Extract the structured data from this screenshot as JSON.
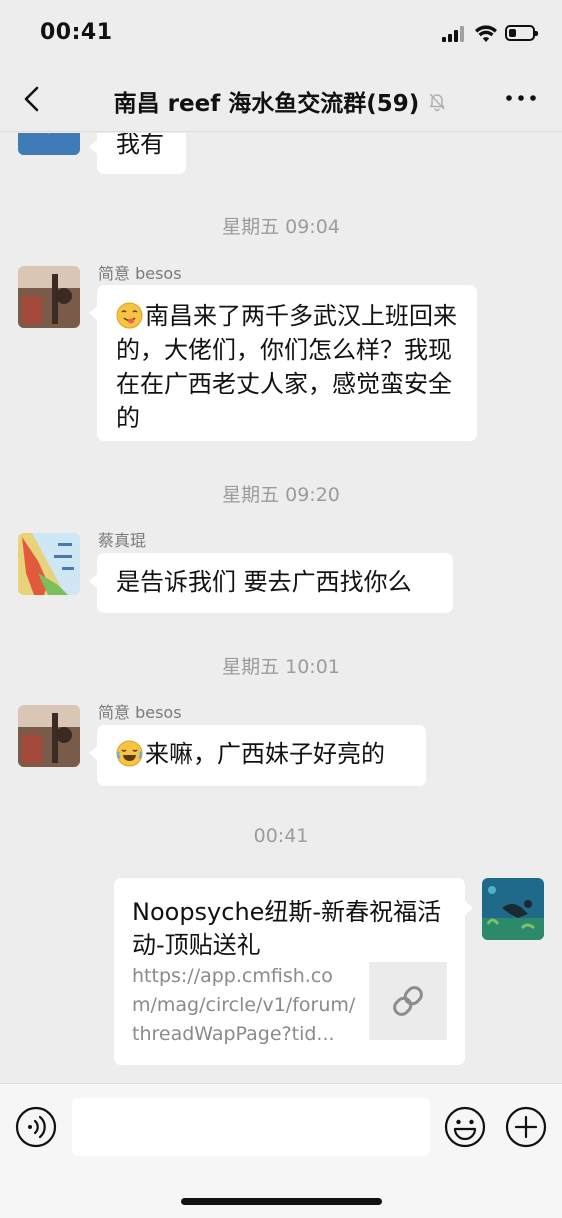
{
  "status_bar": {
    "time": "00:41",
    "battery_level": 0.3
  },
  "header": {
    "title": "南昌 reef 海水鱼交流群(59)",
    "muted": true
  },
  "messages": {
    "m0": {
      "text": "我有"
    },
    "t1": "星期五 09:04",
    "m1": {
      "sender": "简意 besos",
      "text": "南昌来了两千多武汉上班回来的，大佬们，你们怎么样？我现在在广西老丈人家，感觉蛮安全的"
    },
    "t2": "星期五 09:20",
    "m2": {
      "sender": "蔡真琨",
      "text": "是告诉我们 要去广西找你么"
    },
    "t3": "星期五 10:01",
    "m3": {
      "sender": "简意 besos",
      "text": "来嘛，广西妹子好亮的"
    },
    "t4": "00:41",
    "m4": {
      "link_title": "Noopsyche纽斯-新春祝福活动-顶贴送礼",
      "link_url": "https://app.cmfish.com/mag/circle/v1/forum/threadWapPage?tid..."
    }
  },
  "input": {
    "placeholder": ""
  },
  "colors": {
    "background": "#ededed",
    "bubble": "#ffffff",
    "secondary_text": "#9c9c9c"
  }
}
